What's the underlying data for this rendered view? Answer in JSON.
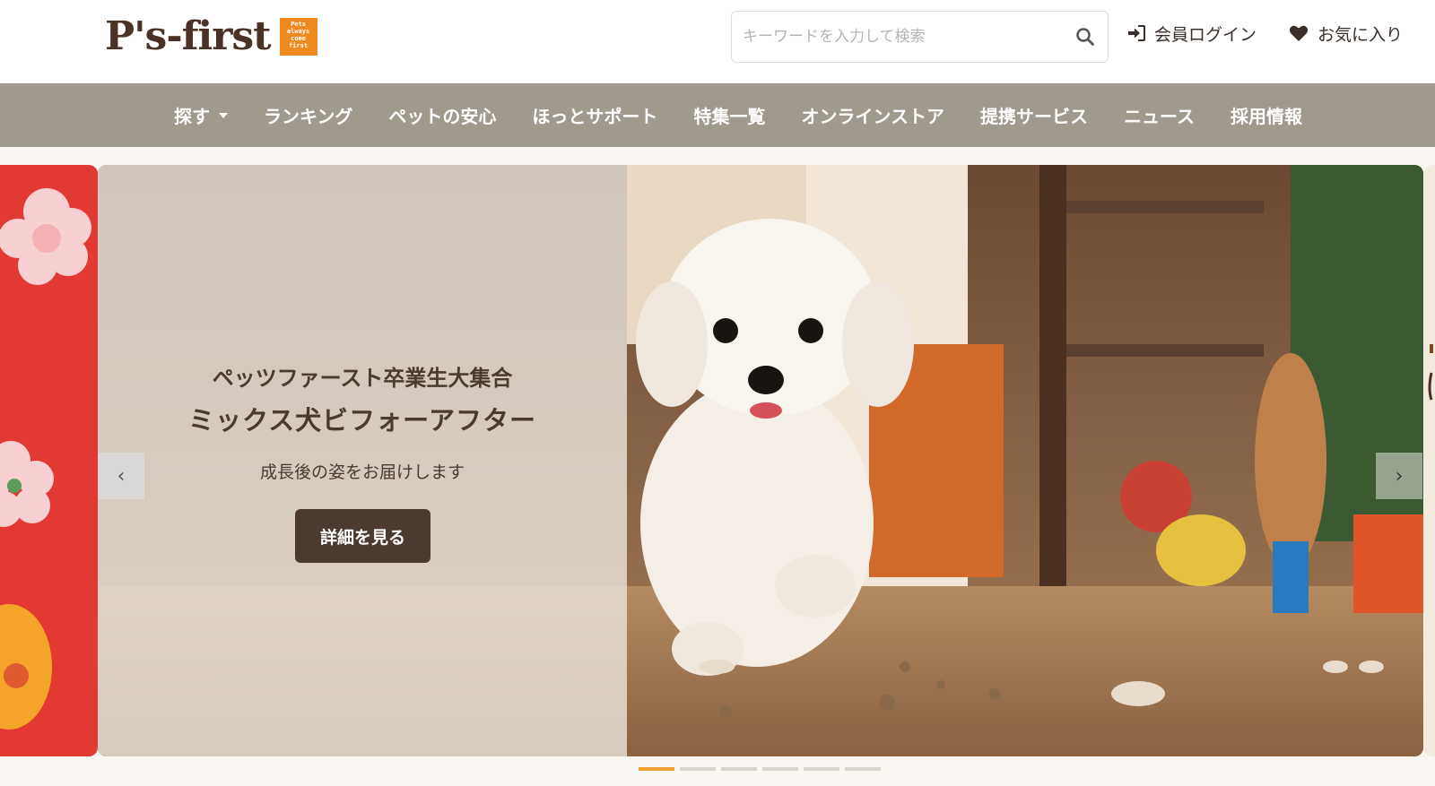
{
  "header": {
    "logo_text": "P's-first",
    "logo_badge": [
      "Pets",
      "always",
      "come",
      "first"
    ],
    "search_placeholder": "キーワードを入力して検索",
    "login_label": "会員ログイン",
    "favorites_label": "お気に入り"
  },
  "nav": {
    "items": [
      "探す",
      "ランキング",
      "ペットの安心",
      "ほっとサポート",
      "特集一覧",
      "オンラインストア",
      "提携サービス",
      "ニュース",
      "採用情報"
    ]
  },
  "slide": {
    "title_line1": "ペッツファースト卒業生大集合",
    "title_line2": "ミックス犬ビフォーアフター",
    "subtitle": "成長後の姿をお届けします",
    "button_label": "詳細を見る",
    "prev_symbol": "‹",
    "next_symbol": "›"
  },
  "carousel": {
    "slide_count": 6,
    "active_index": 0
  },
  "colors": {
    "nav_bg": "#a09a8e",
    "brand_orange": "#f08a1e",
    "button_bg": "#4a3a30",
    "side_slide_red": "#e23a33",
    "dot_active": "#f0a030"
  }
}
